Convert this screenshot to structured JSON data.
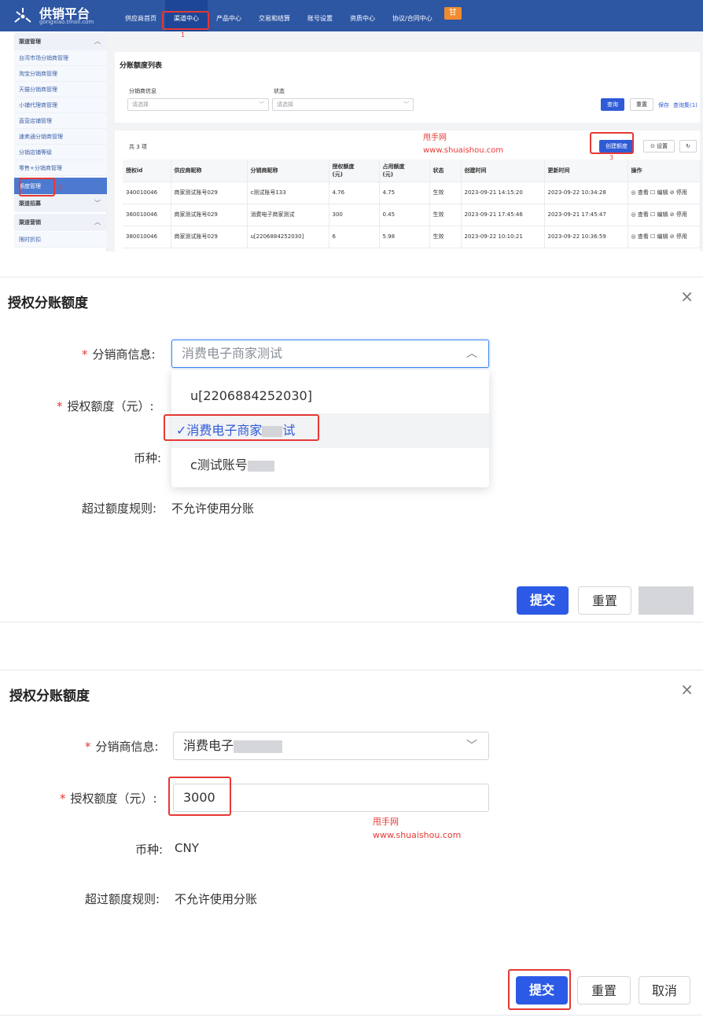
{
  "panel1": {
    "logo": {
      "title": "供销平台",
      "subtitle": "gongxiao.tmall.com"
    },
    "nav": [
      "供应商首页",
      "渠道中心",
      "产品中心",
      "交易和结算",
      "账号设置",
      "资质中心",
      "协议/合同中心"
    ],
    "nav_badge": "甘",
    "annotations": {
      "n1": "1",
      "n2": "2",
      "n3": "3"
    },
    "sidebar": {
      "group_channel_mgmt": "渠道管理",
      "items": [
        "台湾市场分销商管理",
        "淘宝分销商管理",
        "天猫分销商管理",
        "小铺代理商管理",
        "直营店铺管理",
        "速卖通分销商管理",
        "分销店铺等级",
        "零售+分销商管理"
      ],
      "active_item": "额度管理",
      "group_recruit": "渠道招募",
      "group_marketing": "渠道营销",
      "sub_item": "限时折扣"
    },
    "section_title": "分账额度列表",
    "filters": {
      "distributor_label": "分销商信息",
      "distributor_placeholder": "请选择",
      "status_label": "状态",
      "status_placeholder": "请选择"
    },
    "buttons": {
      "query": "查询",
      "reset": "重置",
      "save": "保存",
      "query_set": "查询集(1)",
      "create": "创建额度",
      "settings": "⊙ 设置",
      "refresh": "↻"
    },
    "count_text": "共 3 项",
    "watermark": {
      "line1": "甩手网",
      "line2": "www.shuaishou.com"
    },
    "table": {
      "headers": [
        "授权id",
        "供应商昵称",
        "分销商昵称",
        "授权额度\n(元)",
        "占用额度\n(元)",
        "状态",
        "创建时间",
        "更新时间",
        "操作"
      ],
      "rows": [
        [
          "340010046",
          "商家测试账号029",
          "c测试账号133",
          "4.76",
          "4.75",
          "生效",
          "2023-09-21 14:15:20",
          "2023-09-22 10:34:28",
          "◎ 查看 ☐ 编辑 ⊘ 停用"
        ],
        [
          "360010046",
          "商家测试账号029",
          "消费电子商家测试",
          "300",
          "0.45",
          "生效",
          "2023-09-21 17:45:46",
          "2023-09-21 17:45:47",
          "◎ 查看 ☐ 编辑 ⊘ 停用"
        ],
        [
          "380010046",
          "商家测试账号029",
          "u[2206884252030]",
          "6",
          "5.98",
          "生效",
          "2023-09-22 10:10:21",
          "2023-09-22 10:36:59",
          "◎ 查看 ☐ 编辑 ⊘ 停用"
        ]
      ]
    }
  },
  "panel2": {
    "title": "授权分账额度",
    "close": "×",
    "distributor_label": "分销商信息:",
    "distributor_value": "消费电子商家测试",
    "amount_label": "授权额度（元）:",
    "currency_label": "币种:",
    "over_rule_label": "超过额度规则:",
    "over_rule_value": "不允许使用分账",
    "dropdown": [
      {
        "label": "u[2206884252030]"
      },
      {
        "label": "消费电子商家",
        "tail": "试"
      },
      {
        "label": "c测试账号"
      }
    ],
    "check": "✓",
    "submit": "提交",
    "reset": "重置"
  },
  "panel3": {
    "title": "授权分账额度",
    "close": "×",
    "distributor_label": "分销商信息:",
    "distributor_value": "消费电子",
    "amount_label": "授权额度（元）:",
    "amount_value": "3000",
    "currency_label": "币种:",
    "currency_value": "CNY",
    "over_rule_label": "超过额度规则:",
    "over_rule_value": "不允许使用分账",
    "watermark": {
      "line1": "甩手网",
      "line2": "www.shuaishou.com"
    },
    "submit": "提交",
    "reset": "重置",
    "cancel": "取消"
  },
  "colors": {
    "topbar": "#2d56a3",
    "primary": "#2c5ae6",
    "annotation": "#e53935"
  }
}
